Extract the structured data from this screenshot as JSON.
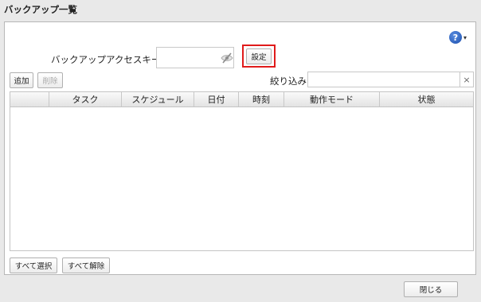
{
  "window": {
    "title": "バックアップ一覧"
  },
  "help": {
    "glyph": "?",
    "caret": "▾",
    "icon": "help-circle-icon"
  },
  "access_key": {
    "label": "バックアップアクセスキー:",
    "value": "",
    "visibility_icon": "eye-slash-icon",
    "set_label": "設定"
  },
  "toolbar": {
    "add_label": "追加",
    "delete_label": "削除"
  },
  "filter": {
    "label": "絞り込み:",
    "value": "",
    "clear_glyph": "×"
  },
  "table": {
    "columns": [
      "",
      "タスク",
      "スケジュール",
      "日付",
      "時刻",
      "動作モード",
      "状態"
    ],
    "rows": []
  },
  "footer": {
    "select_all_label": "すべて選択",
    "deselect_all_label": "すべて解除",
    "close_label": "閉じる"
  },
  "colors": {
    "highlight_border": "#e01b1b",
    "help_blue": "#1b4fae",
    "background": "#e9e9e9"
  }
}
